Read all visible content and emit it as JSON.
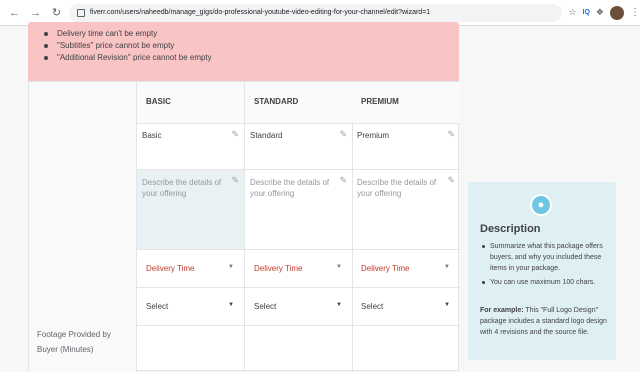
{
  "browser": {
    "url": "fiverr.com/users/naheedb/manage_gigs/do-professional-youtube-video-editing-for-your-channel/edit?wizard=1",
    "ext_label": "IQ"
  },
  "errors": [
    "Delivery time can't be empty",
    "\"Subtitles\" price cannot be empty",
    "\"Additional Revision\" price cannot be empty"
  ],
  "packages": [
    {
      "header": "BASIC",
      "name": "Basic",
      "desc_placeholder": "Describe the details of your offering",
      "delivery": "Delivery Time",
      "select": "Select"
    },
    {
      "header": "STANDARD",
      "name": "Standard",
      "desc_placeholder": "Describe the details of your offering",
      "delivery": "Delivery Time",
      "select": "Select"
    },
    {
      "header": "PREMIUM",
      "name": "Premium",
      "desc_placeholder": "Describe the details of your offering",
      "delivery": "Delivery Time",
      "select": "Select"
    }
  ],
  "row_label": "Footage Provided by Buyer (Minutes)",
  "description_panel": {
    "title": "Description",
    "bullets": [
      "Summarize what this package offers buyers, and why you included these items in your package.",
      "You can use maximum 100 chars."
    ],
    "example_label": "For example:",
    "example_text": "This \"Full Logo Design\" package includes a standard logo design with 4 revisions and the source file."
  },
  "colors": {
    "error_bg": "#f8c4c4",
    "delivery_text": "#c0392b",
    "panel_bg": "#dff0f5",
    "bulb": "#6ec6e2"
  },
  "icons": {
    "back": "arrow-left",
    "forward": "arrow-right",
    "reload": "reload",
    "lock": "lock",
    "star": "star",
    "extensions": "puzzle",
    "pencil": "pencil",
    "caret": "caret-down",
    "bulb": "lightbulb"
  }
}
